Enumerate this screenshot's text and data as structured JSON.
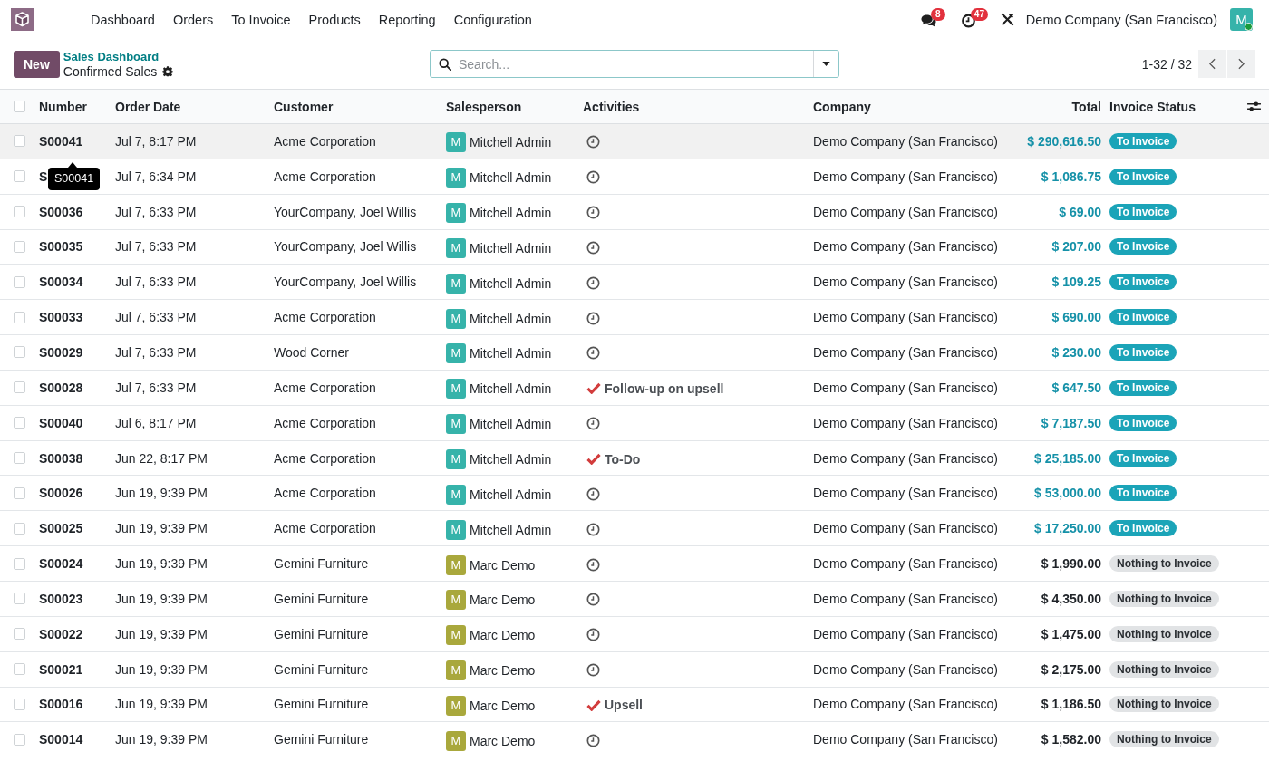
{
  "navbar": {
    "menu": [
      {
        "label": "Dashboard"
      },
      {
        "label": "Orders"
      },
      {
        "label": "To Invoice"
      },
      {
        "label": "Products"
      },
      {
        "label": "Reporting"
      },
      {
        "label": "Configuration"
      }
    ],
    "messages": {
      "count": "8"
    },
    "activities": {
      "count": "47"
    },
    "company": "Demo Company (San Francisco)",
    "user": {
      "initial": "M",
      "online": true
    }
  },
  "control_panel": {
    "new_button": "New",
    "breadcrumb": {
      "parent": "Sales Dashboard",
      "current": "Confirmed Sales"
    },
    "search": {
      "placeholder": "Search..."
    },
    "pager": {
      "range": "1-32 / 32"
    }
  },
  "table": {
    "select_all": {
      "checked": false
    },
    "columns": [
      {
        "label": "Number"
      },
      {
        "label": "Order Date"
      },
      {
        "label": "Customer"
      },
      {
        "label": "Salesperson"
      },
      {
        "label": "Activities"
      },
      {
        "label": "Company"
      },
      {
        "label": "Total"
      },
      {
        "label": "Invoice Status"
      }
    ],
    "rows": [
      {
        "checked": false,
        "highlighted": true,
        "number": "S00041",
        "order_date": "Jul 7, 8:17 PM",
        "customer": "Acme Corporation",
        "salesperson": {
          "initial": "M",
          "name": "Mitchell Admin",
          "color": "#36b3aa"
        },
        "activity": {
          "kind": "clock"
        },
        "company": "Demo Company (San Francisco)",
        "total": "$ 290,616.50",
        "invoice_status": {
          "label": "To Invoice",
          "kind": "info"
        }
      },
      {
        "checked": false,
        "highlighted": false,
        "number": "S",
        "tooltip": "S00041",
        "order_date": "Jul 7, 6:34 PM",
        "customer": "Acme Corporation",
        "salesperson": {
          "initial": "M",
          "name": "Mitchell Admin",
          "color": "#36b3aa"
        },
        "activity": {
          "kind": "clock"
        },
        "company": "Demo Company (San Francisco)",
        "total": "$ 1,086.75",
        "invoice_status": {
          "label": "To Invoice",
          "kind": "info"
        }
      },
      {
        "checked": false,
        "highlighted": false,
        "number": "S00036",
        "order_date": "Jul 7, 6:33 PM",
        "customer": "YourCompany, Joel Willis",
        "salesperson": {
          "initial": "M",
          "name": "Mitchell Admin",
          "color": "#36b3aa"
        },
        "activity": {
          "kind": "clock"
        },
        "company": "Demo Company (San Francisco)",
        "total": "$ 69.00",
        "invoice_status": {
          "label": "To Invoice",
          "kind": "info"
        }
      },
      {
        "checked": false,
        "highlighted": false,
        "number": "S00035",
        "order_date": "Jul 7, 6:33 PM",
        "customer": "YourCompany, Joel Willis",
        "salesperson": {
          "initial": "M",
          "name": "Mitchell Admin",
          "color": "#36b3aa"
        },
        "activity": {
          "kind": "clock"
        },
        "company": "Demo Company (San Francisco)",
        "total": "$ 207.00",
        "invoice_status": {
          "label": "To Invoice",
          "kind": "info"
        }
      },
      {
        "checked": false,
        "highlighted": false,
        "number": "S00034",
        "order_date": "Jul 7, 6:33 PM",
        "customer": "YourCompany, Joel Willis",
        "salesperson": {
          "initial": "M",
          "name": "Mitchell Admin",
          "color": "#36b3aa"
        },
        "activity": {
          "kind": "clock"
        },
        "company": "Demo Company (San Francisco)",
        "total": "$ 109.25",
        "invoice_status": {
          "label": "To Invoice",
          "kind": "info"
        }
      },
      {
        "checked": false,
        "highlighted": false,
        "number": "S00033",
        "order_date": "Jul 7, 6:33 PM",
        "customer": "Acme Corporation",
        "salesperson": {
          "initial": "M",
          "name": "Mitchell Admin",
          "color": "#36b3aa"
        },
        "activity": {
          "kind": "clock"
        },
        "company": "Demo Company (San Francisco)",
        "total": "$ 690.00",
        "invoice_status": {
          "label": "To Invoice",
          "kind": "info"
        }
      },
      {
        "checked": false,
        "highlighted": false,
        "number": "S00029",
        "order_date": "Jul 7, 6:33 PM",
        "customer": "Wood Corner",
        "salesperson": {
          "initial": "M",
          "name": "Mitchell Admin",
          "color": "#36b3aa"
        },
        "activity": {
          "kind": "clock"
        },
        "company": "Demo Company (San Francisco)",
        "total": "$ 230.00",
        "invoice_status": {
          "label": "To Invoice",
          "kind": "info"
        }
      },
      {
        "checked": false,
        "highlighted": false,
        "number": "S00028",
        "order_date": "Jul 7, 6:33 PM",
        "customer": "Acme Corporation",
        "salesperson": {
          "initial": "M",
          "name": "Mitchell Admin",
          "color": "#36b3aa"
        },
        "activity": {
          "kind": "todo",
          "label": "Follow-up on upsell"
        },
        "company": "Demo Company (San Francisco)",
        "total": "$ 647.50",
        "invoice_status": {
          "label": "To Invoice",
          "kind": "info"
        }
      },
      {
        "checked": false,
        "highlighted": false,
        "number": "S00040",
        "order_date": "Jul 6, 8:17 PM",
        "customer": "Acme Corporation",
        "salesperson": {
          "initial": "M",
          "name": "Mitchell Admin",
          "color": "#36b3aa"
        },
        "activity": {
          "kind": "clock"
        },
        "company": "Demo Company (San Francisco)",
        "total": "$ 7,187.50",
        "invoice_status": {
          "label": "To Invoice",
          "kind": "info"
        }
      },
      {
        "checked": false,
        "highlighted": false,
        "number": "S00038",
        "order_date": "Jun 22, 8:17 PM",
        "customer": "Acme Corporation",
        "salesperson": {
          "initial": "M",
          "name": "Mitchell Admin",
          "color": "#36b3aa"
        },
        "activity": {
          "kind": "todo",
          "label": "To-Do"
        },
        "company": "Demo Company (San Francisco)",
        "total": "$ 25,185.00",
        "invoice_status": {
          "label": "To Invoice",
          "kind": "info"
        }
      },
      {
        "checked": false,
        "highlighted": false,
        "number": "S00026",
        "order_date": "Jun 19, 9:39 PM",
        "customer": "Acme Corporation",
        "salesperson": {
          "initial": "M",
          "name": "Mitchell Admin",
          "color": "#36b3aa"
        },
        "activity": {
          "kind": "clock"
        },
        "company": "Demo Company (San Francisco)",
        "total": "$ 53,000.00",
        "invoice_status": {
          "label": "To Invoice",
          "kind": "info"
        }
      },
      {
        "checked": false,
        "highlighted": false,
        "number": "S00025",
        "order_date": "Jun 19, 9:39 PM",
        "customer": "Acme Corporation",
        "salesperson": {
          "initial": "M",
          "name": "Mitchell Admin",
          "color": "#36b3aa"
        },
        "activity": {
          "kind": "clock"
        },
        "company": "Demo Company (San Francisco)",
        "total": "$ 17,250.00",
        "invoice_status": {
          "label": "To Invoice",
          "kind": "info"
        }
      },
      {
        "checked": false,
        "highlighted": false,
        "number": "S00024",
        "order_date": "Jun 19, 9:39 PM",
        "customer": "Gemini Furniture",
        "salesperson": {
          "initial": "M",
          "name": "Marc Demo",
          "color": "#a9a83c"
        },
        "activity": {
          "kind": "clock"
        },
        "company": "Demo Company (San Francisco)",
        "total": "$ 1,990.00",
        "invoice_status": {
          "label": "Nothing to Invoice",
          "kind": "neutral"
        }
      },
      {
        "checked": false,
        "highlighted": false,
        "number": "S00023",
        "order_date": "Jun 19, 9:39 PM",
        "customer": "Gemini Furniture",
        "salesperson": {
          "initial": "M",
          "name": "Marc Demo",
          "color": "#a9a83c"
        },
        "activity": {
          "kind": "clock"
        },
        "company": "Demo Company (San Francisco)",
        "total": "$ 4,350.00",
        "invoice_status": {
          "label": "Nothing to Invoice",
          "kind": "neutral"
        }
      },
      {
        "checked": false,
        "highlighted": false,
        "number": "S00022",
        "order_date": "Jun 19, 9:39 PM",
        "customer": "Gemini Furniture",
        "salesperson": {
          "initial": "M",
          "name": "Marc Demo",
          "color": "#a9a83c"
        },
        "activity": {
          "kind": "clock"
        },
        "company": "Demo Company (San Francisco)",
        "total": "$ 1,475.00",
        "invoice_status": {
          "label": "Nothing to Invoice",
          "kind": "neutral"
        }
      },
      {
        "checked": false,
        "highlighted": false,
        "number": "S00021",
        "order_date": "Jun 19, 9:39 PM",
        "customer": "Gemini Furniture",
        "salesperson": {
          "initial": "M",
          "name": "Marc Demo",
          "color": "#a9a83c"
        },
        "activity": {
          "kind": "clock"
        },
        "company": "Demo Company (San Francisco)",
        "total": "$ 2,175.00",
        "invoice_status": {
          "label": "Nothing to Invoice",
          "kind": "neutral"
        }
      },
      {
        "checked": false,
        "highlighted": false,
        "number": "S00016",
        "order_date": "Jun 19, 9:39 PM",
        "customer": "Gemini Furniture",
        "salesperson": {
          "initial": "M",
          "name": "Marc Demo",
          "color": "#a9a83c"
        },
        "activity": {
          "kind": "todo",
          "label": "Upsell"
        },
        "company": "Demo Company (San Francisco)",
        "total": "$ 1,186.50",
        "invoice_status": {
          "label": "Nothing to Invoice",
          "kind": "neutral"
        }
      },
      {
        "checked": false,
        "highlighted": false,
        "number": "S00014",
        "order_date": "Jun 19, 9:39 PM",
        "customer": "Gemini Furniture",
        "salesperson": {
          "initial": "M",
          "name": "Marc Demo",
          "color": "#a9a83c"
        },
        "activity": {
          "kind": "clock"
        },
        "company": "Demo Company (San Francisco)",
        "total": "$ 1,582.00",
        "invoice_status": {
          "label": "Nothing to Invoice",
          "kind": "neutral"
        }
      }
    ]
  }
}
